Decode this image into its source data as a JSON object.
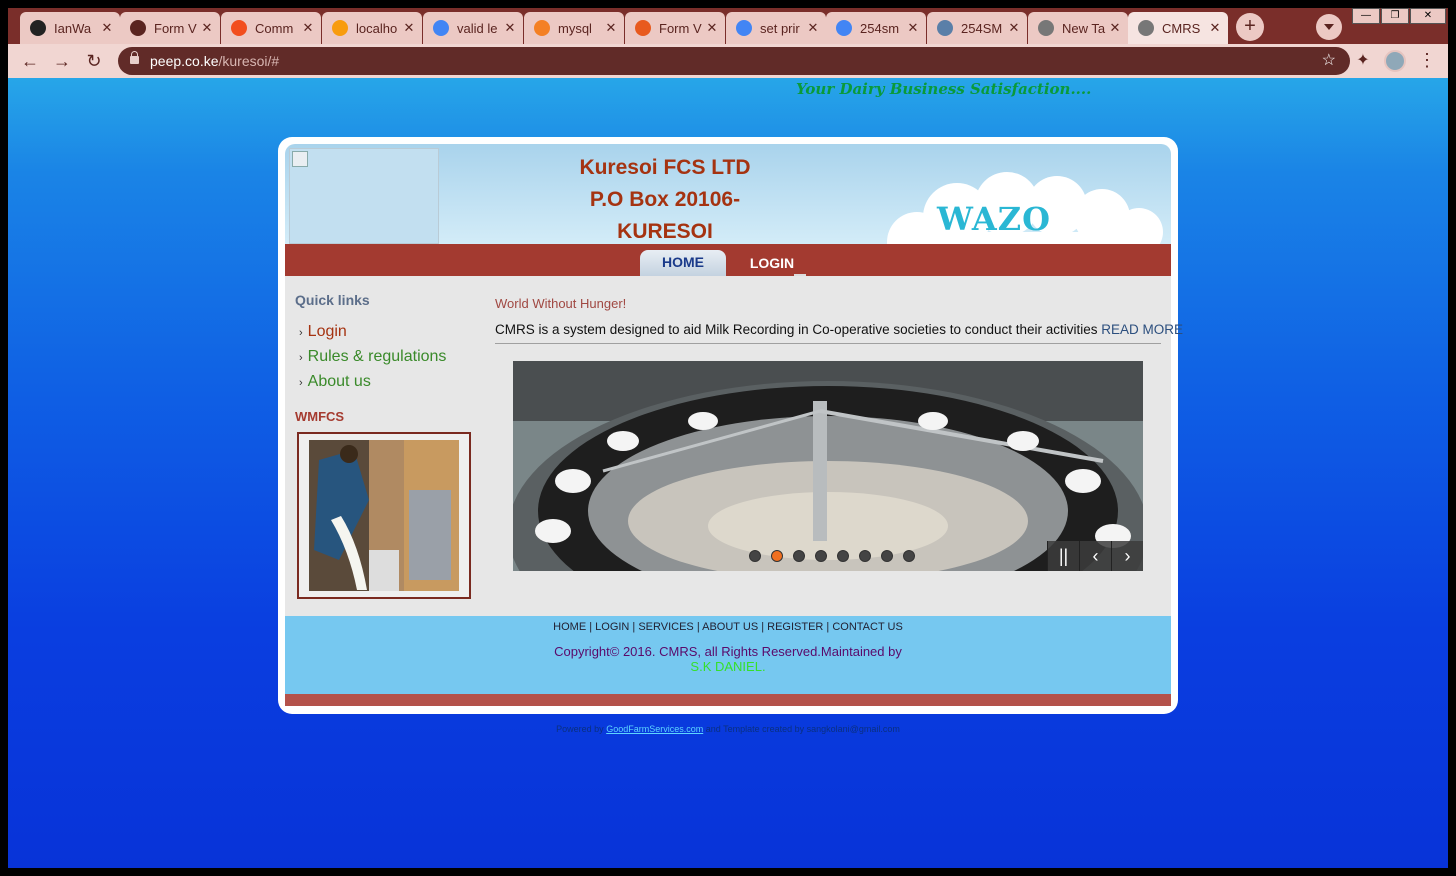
{
  "browser": {
    "tabs": [
      {
        "label": "IanWa",
        "icon": "github-icon",
        "color": "#222222"
      },
      {
        "label": "Form V",
        "icon": "globe-icon",
        "color": "#5a2420"
      },
      {
        "label": "Comm",
        "icon": "figma-icon",
        "color": "#f24e1e"
      },
      {
        "label": "localho",
        "icon": "phpmyadmin-icon",
        "color": "#f89c0e"
      },
      {
        "label": "valid le",
        "icon": "google-icon",
        "color": "#4285f4"
      },
      {
        "label": "mysql",
        "icon": "stackoverflow-icon",
        "color": "#f48024"
      },
      {
        "label": "Form V",
        "icon": "form-icon",
        "color": "#e85a1e"
      },
      {
        "label": "set prir",
        "icon": "google-icon",
        "color": "#4285f4"
      },
      {
        "label": "254sm",
        "icon": "google-icon",
        "color": "#4285f4"
      },
      {
        "label": "254SM",
        "icon": "mail-icon",
        "color": "#5a7fa8"
      },
      {
        "label": "New Ta",
        "icon": "chrome-icon",
        "color": "#777777"
      },
      {
        "label": "CMRS",
        "icon": "globe-icon",
        "color": "#777777"
      }
    ],
    "window_controls": [
      "—",
      "❐",
      "✕"
    ],
    "url_host": "peep.co.ke",
    "url_path": "/kuresoi/#",
    "new_tab": "+",
    "back": "←",
    "forward": "→",
    "reload": "↻",
    "star": "☆",
    "menu": "⋮",
    "extensions": "✦"
  },
  "page": {
    "tagline": "Your Dairy Business Satisfaction....",
    "org_line1": "Kuresoi FCS LTD",
    "org_line2": "P.O Box 20106-",
    "org_line3": "KURESOI",
    "brand": "WAZO",
    "nav": {
      "home": "HOME",
      "login": "LOGIN"
    },
    "sidebar": {
      "title": "Quick links",
      "links": [
        "Login",
        "Rules & regulations",
        "About us"
      ],
      "arrow": "›",
      "section": "WMFCS"
    },
    "main": {
      "motto": "World Without Hunger!",
      "intro": "CMRS is a system designed to aid Milk Recording in Co-operative societies to conduct their activities",
      "read_more": "READ MORE"
    },
    "slider": {
      "dots": 8,
      "active_dot": 2,
      "pause": "||",
      "prev": "‹",
      "next": "›"
    },
    "footer": {
      "links": "HOME | LOGIN | SERVICES | ABOUT US | REGISTER | CONTACT US",
      "copyright": "Copyright© 2016. CMRS, all Rights Reserved.Maintained by",
      "maintainer": "S.K DANIEL."
    },
    "powered": {
      "prefix": "Powered by",
      "link": "GoodFarmServices.com",
      "suffix": "and Template created by sangkolani@gmail.com"
    }
  }
}
